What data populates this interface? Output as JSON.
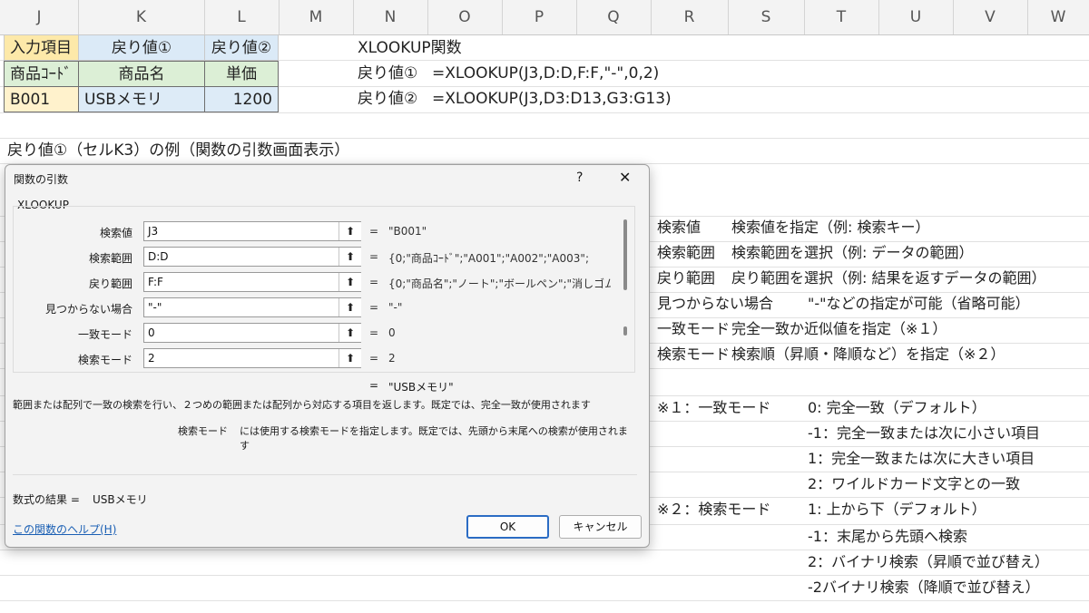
{
  "columns": [
    "J",
    "K",
    "L",
    "M",
    "N",
    "O",
    "P",
    "Q",
    "R",
    "S",
    "T",
    "U",
    "V",
    "W"
  ],
  "table": {
    "header_row": [
      "入力項目",
      "戻り値①",
      "戻り値②"
    ],
    "label_row": [
      "商品ｺｰﾄﾞ",
      "商品名",
      "単価"
    ],
    "data_row": [
      "B001",
      "USBメモリ",
      "1200"
    ]
  },
  "formulas": {
    "title": "XLOOKUP関数",
    "items": [
      {
        "label": "戻り値①",
        "formula": "=XLOOKUP(J3,D:D,F:F,\"-\",0,2)"
      },
      {
        "label": "戻り値②",
        "formula": "=XLOOKUP(J3,D3:D13,G3:G13)"
      }
    ]
  },
  "example_caption": "戻り値①（セルK3）の例（関数の引数画面表示）",
  "dialog": {
    "title": "関数の引数",
    "help_glyph": "?",
    "close_glyph": "✕",
    "function_name": "XLOOKUP",
    "args": [
      {
        "label": "検索値",
        "value": "J3",
        "eq": "=",
        "result": "\"B001\""
      },
      {
        "label": "検索範囲",
        "value": "D:D",
        "eq": "=",
        "result": "{0;\"商品ｺｰﾄﾞ\";\"A001\";\"A002\";\"A003\";"
      },
      {
        "label": "戻り範囲",
        "value": "F:F",
        "eq": "=",
        "result": "{0;\"商品名\";\"ノート\";\"ボールペン\";\"消しゴム"
      },
      {
        "label": "見つからない場合",
        "value": "\"-\"",
        "eq": "=",
        "result": "\"-\""
      },
      {
        "label": "一致モード",
        "value": "0",
        "eq": "=",
        "result": "0"
      },
      {
        "label": "検索モード",
        "value": "2",
        "eq": "=",
        "result": "2"
      }
    ],
    "ref_button_glyph": "⬆",
    "overall_eq": "=",
    "overall_result": "\"USBメモリ\"",
    "description": "範囲または配列で一致の検索を行い、２つめの範囲または配列から対応する項目を返します。既定では、完全一致が使用されます",
    "arg_help_name": "検索モード",
    "arg_help_text_1": "には使用する検索モードを指定します。既定では、先頭から末尾への検索が使用されま",
    "arg_help_text_2": "す",
    "formula_result_label": "数式の結果 =",
    "formula_result_value": "USBメモリ",
    "help_link": "この関数のヘルプ(H)",
    "ok_label": "OK",
    "cancel_label": "キャンセル"
  },
  "arg_notes": [
    {
      "term": "検索値",
      "desc": "検索値を指定（例: 検索キー）"
    },
    {
      "term": "検索範囲",
      "desc": "検索範囲を選択（例: データの範囲）"
    },
    {
      "term": "戻り範囲",
      "desc": "戻り範囲を選択（例: 結果を返すデータの範囲）"
    },
    {
      "term": "見つからない場合",
      "desc": "\"-\"などの指定が可能（省略可能）"
    },
    {
      "term": "一致モード",
      "desc": "完全一致か近似値を指定（※１）"
    },
    {
      "term": "検索モード",
      "desc": "検索順（昇順・降順など）を指定（※２）"
    }
  ],
  "match_mode": {
    "heading": "※１：一致モード",
    "options": [
      "0: 完全一致（デフォルト）",
      "-1：完全一致または次に小さい項目",
      "1：完全一致または次に大きい項目",
      "2：ワイルドカード文字との一致"
    ]
  },
  "search_mode": {
    "heading": "※２：検索モード",
    "options": [
      "1: 上から下（デフォルト）",
      "-1：末尾から先頭へ検索",
      "2：バイナリ検索（昇順で並び替え）",
      "-2バイナリ検索（降順で並び替え）"
    ]
  },
  "colors": {
    "input_header_fill": "#fde9a9",
    "return_header_fill": "#dbeaf7",
    "label_fill": "#dcefd6",
    "data_code_fill": "#fff2cc",
    "data_value_fill": "#ddebf7",
    "link": "#1a5fb4"
  }
}
